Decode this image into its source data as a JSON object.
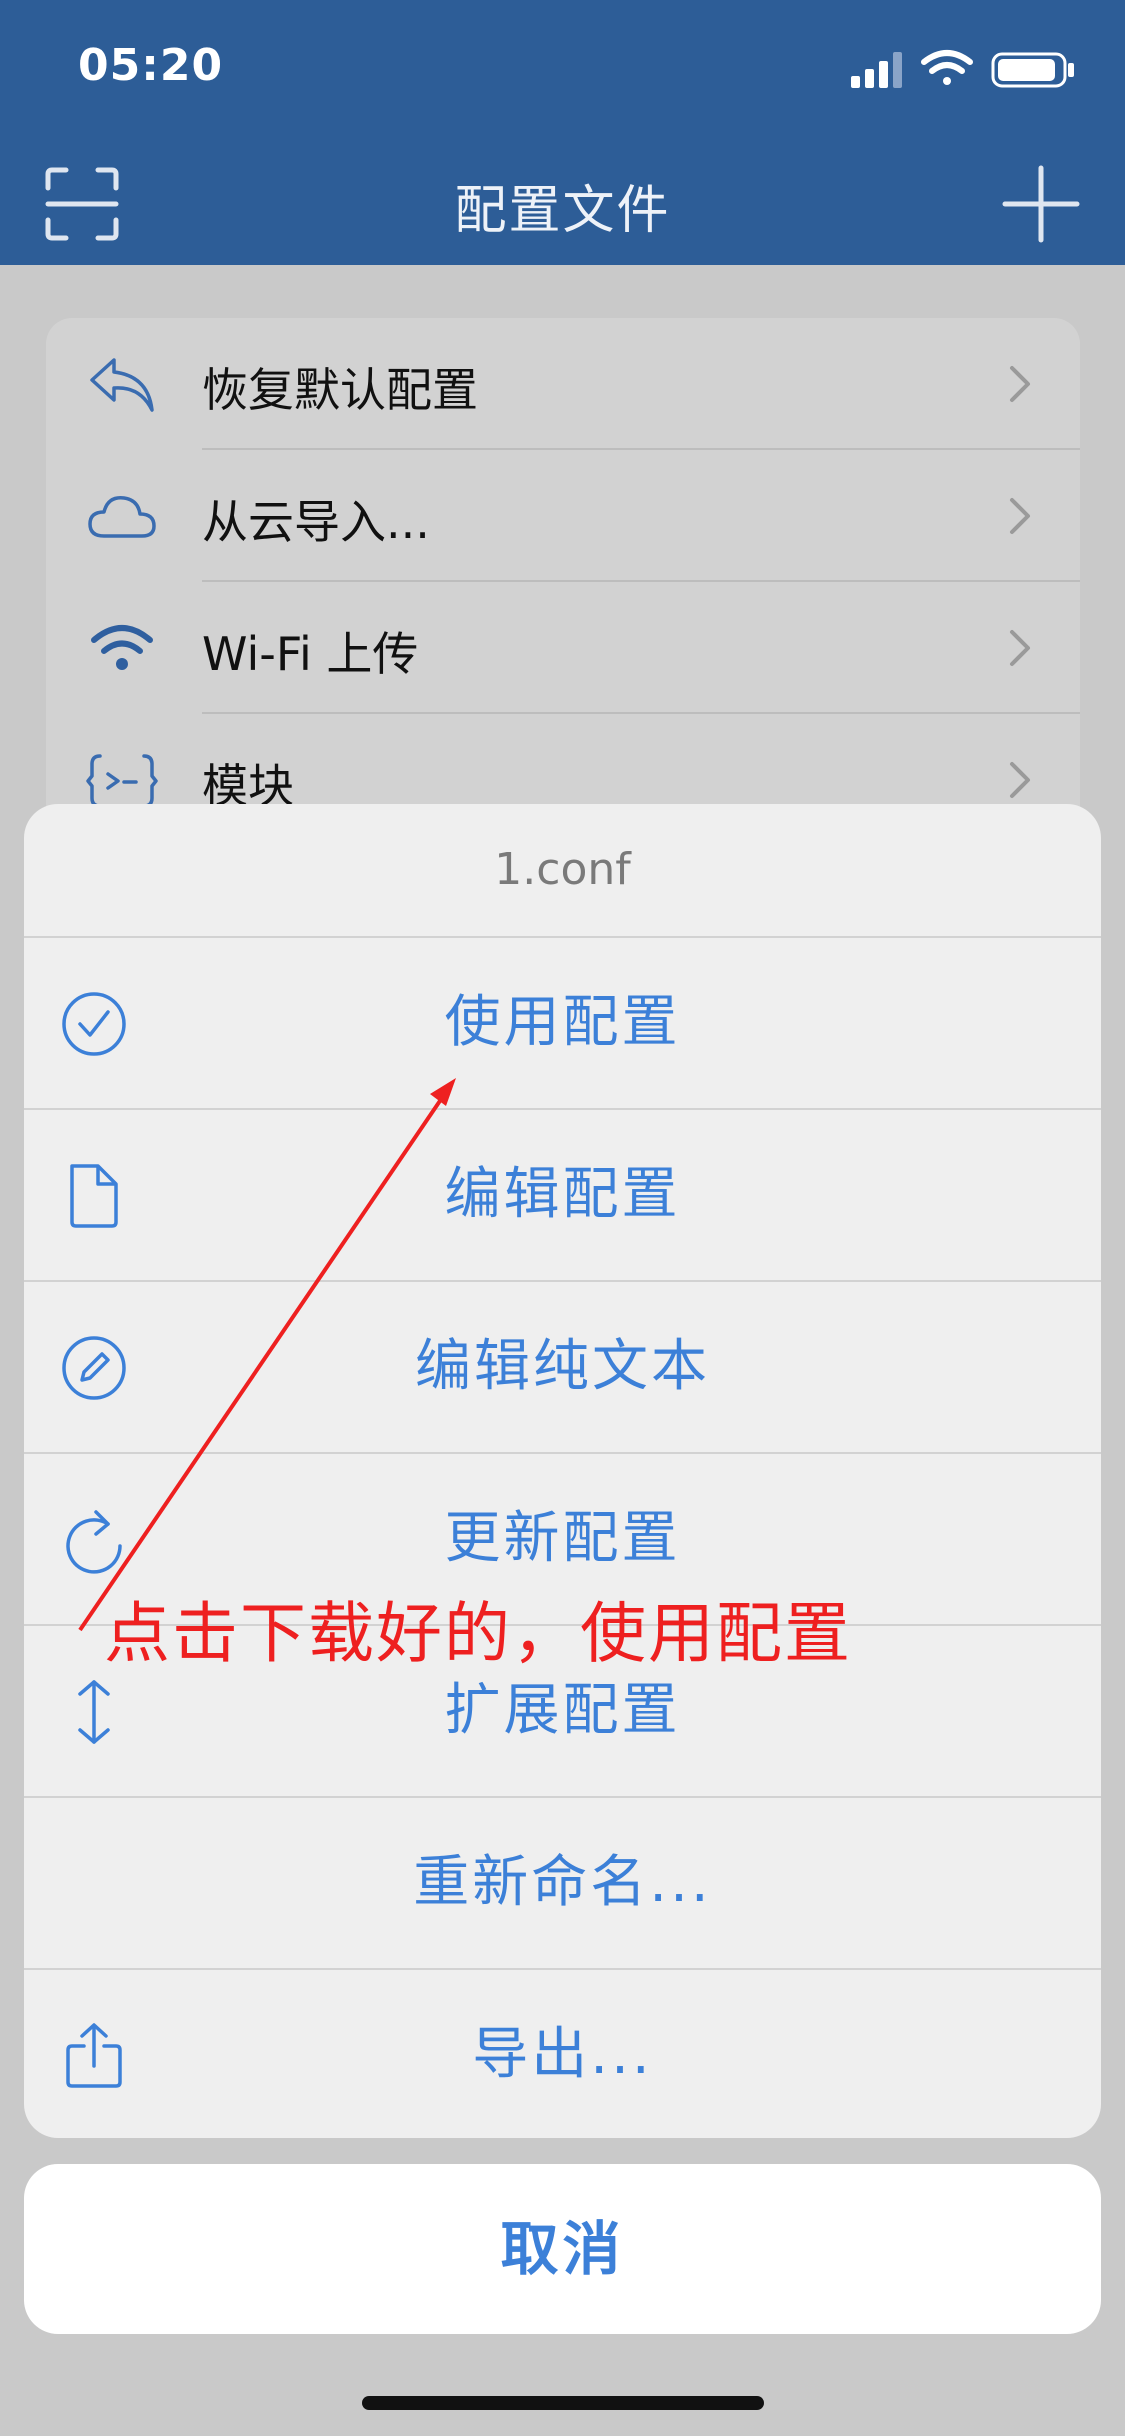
{
  "status": {
    "time": "05:20"
  },
  "nav": {
    "title": "配置文件"
  },
  "list": {
    "items": [
      {
        "label": "恢复默认配置",
        "icon": "undo-icon"
      },
      {
        "label": "从云导入...",
        "icon": "cloud-icon"
      },
      {
        "label": "Wi-Fi 上传",
        "icon": "wifi-icon"
      },
      {
        "label": "模块",
        "icon": "module-icon"
      }
    ]
  },
  "sheet": {
    "title": "1.conf",
    "actions": [
      {
        "label": "使用配置",
        "icon": "check-circle-icon"
      },
      {
        "label": "编辑配置",
        "icon": "document-icon"
      },
      {
        "label": "编辑纯文本",
        "icon": "pencil-circle-icon"
      },
      {
        "label": "更新配置",
        "icon": "refresh-icon"
      },
      {
        "label": "扩展配置",
        "icon": "expand-vertical-icon"
      },
      {
        "label": "重新命名...",
        "icon": ""
      },
      {
        "label": "导出...",
        "icon": "share-icon"
      }
    ],
    "cancel": "取消"
  },
  "annotation": {
    "text": "点击下载好的，使用配置"
  },
  "colors": {
    "nav_bg": "#2d5d97",
    "accent": "#3c80d8",
    "annotation": "#ee2020"
  }
}
